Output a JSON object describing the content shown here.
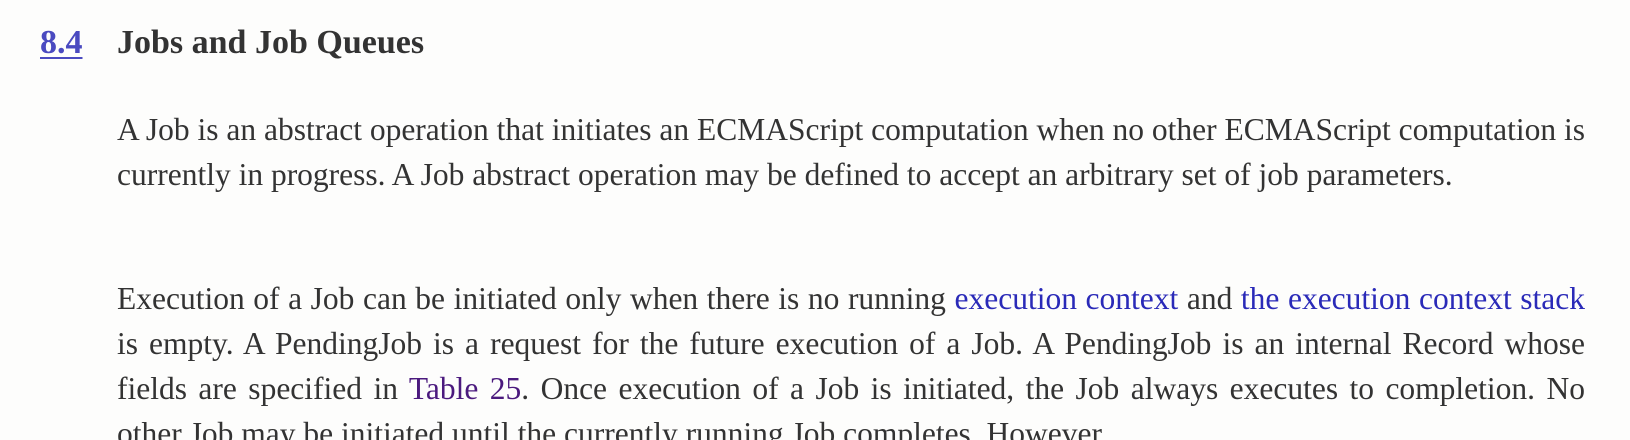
{
  "section": {
    "number": "8.4",
    "title": "Jobs and Job Queues"
  },
  "paragraphs": {
    "p1": "A Job is an abstract operation that initiates an ECMAScript computation when no other ECMAScript computation is currently in progress. A Job abstract operation may be defined to accept an arbitrary set of job parameters.",
    "p2": {
      "t1": "Execution of a Job can be initiated only when there is no running ",
      "link1": "execution context",
      "t2": " and ",
      "link2": "the execution context stack",
      "t3": " is empty. A PendingJob is a request for the future execution of a Job. A PendingJob is an internal Record whose fields are specified in ",
      "link3": "Table 25",
      "t4": ". Once execution of a Job is initiated, the Job always executes to completion. No other Job may be initiated until the currently running Job completes. However,"
    }
  },
  "colors": {
    "text": "#333333",
    "link": "#2a2ab8",
    "visited_link": "#4b1a7e",
    "section_number": "#4a4ac0",
    "background": "#fdfdfc"
  }
}
